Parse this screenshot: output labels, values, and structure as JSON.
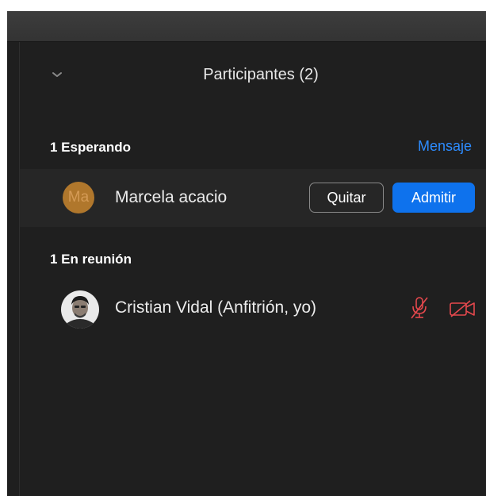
{
  "panel": {
    "title": "Participantes (2)"
  },
  "waiting": {
    "label": "1 Esperando",
    "message_link": "Mensaje",
    "participants": [
      {
        "initials": "Ma",
        "name": "Marcela acacio",
        "remove_label": "Quitar",
        "admit_label": "Admitir"
      }
    ]
  },
  "in_meeting": {
    "label": "1 En reunión",
    "participants": [
      {
        "name": "Cristian Vidal (Anfitrión, yo)",
        "mic_icon": "mic-muted-icon",
        "video_icon": "video-off-icon"
      }
    ]
  },
  "colors": {
    "background": "#1f1f1f",
    "accent": "#0e72ed",
    "link": "#2d8cff",
    "muted_red": "#e5484d",
    "avatar_orange": "#b0772c"
  }
}
